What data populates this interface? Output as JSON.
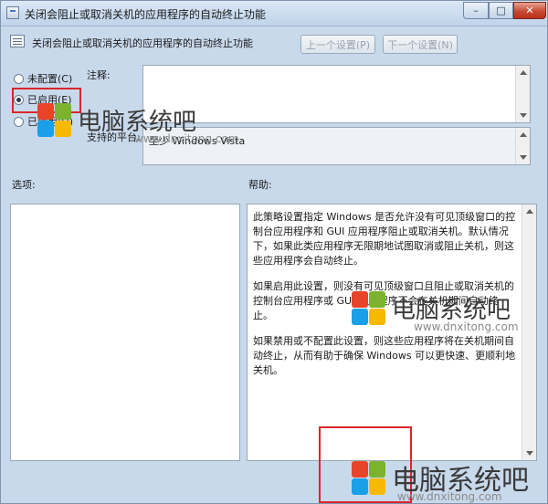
{
  "window": {
    "title": "关闭会阻止或取消关机的应用程序的自动终止功能",
    "controls": {
      "minimize": "–",
      "maximize": "□",
      "close": "✕"
    }
  },
  "header": {
    "title": "关闭会阻止或取消关机的应用程序的自动终止功能",
    "prev_button": "上一个设置(P)",
    "next_button": "下一个设置(N)"
  },
  "options": [
    {
      "label": "未配置(C)",
      "checked": false
    },
    {
      "label": "已启用(E)",
      "checked": true
    },
    {
      "label": "已禁用(D)",
      "checked": false
    }
  ],
  "comment": {
    "label": "注释:",
    "value": ""
  },
  "supported_on": {
    "label": "支持的平台:",
    "value": "至少 Windows Vista"
  },
  "options_section": {
    "label": "选项:"
  },
  "help_section": {
    "label": "帮助:",
    "paragraphs": [
      "此策略设置指定 Windows 是否允许没有可见顶级窗口的控制台应用程序和 GUI 应用程序阻止或取消关机。默认情况下，如果此类应用程序无限期地试图取消或阻止关机，则这些应用程序会自动终止。",
      "如果启用此设置，则没有可见顶级窗口且阻止或取消关机的控制台应用程序或 GUI 应用程序不会在关机期间自动终止。",
      "如果禁用或不配置此设置，则这些应用程序将在关机期间自动终止，从而有助于确保 Windows 可以更快速、更顺利地关机。"
    ]
  },
  "watermarks": [
    {
      "name": "电脑系统吧",
      "url": "www.dnxitong.com"
    },
    {
      "name": "电脑系统吧",
      "url": "www.dnxitong.com"
    },
    {
      "name": "电脑系统吧",
      "url": "www.dnxitong.com"
    }
  ],
  "colors": {
    "highlight_box": "#d9262b",
    "window_bg": "#c9d9ec",
    "close_button": "#c94a33"
  }
}
